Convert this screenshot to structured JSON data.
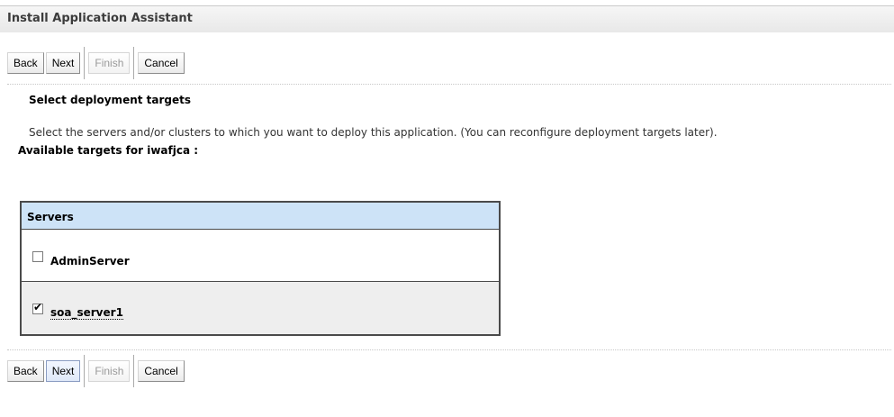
{
  "window": {
    "title": "Install Application Assistant"
  },
  "toolbar": {
    "back_label": "Back",
    "next_label": "Next",
    "finish_label": "Finish",
    "cancel_label": "Cancel"
  },
  "section": {
    "heading": "Select deployment targets",
    "description": "Select the servers and/or clusters to which you want to deploy this application. (You can reconfigure deployment targets later).",
    "available_label": "Available targets for iwafjca :"
  },
  "servers_table": {
    "header": "Servers",
    "rows": [
      {
        "name": "AdminServer",
        "checked": false
      },
      {
        "name": "soa_server1",
        "checked": true
      }
    ]
  },
  "colors": {
    "table_header_bg": "#cde3f7",
    "selected_row_bg": "#eeeeee"
  }
}
